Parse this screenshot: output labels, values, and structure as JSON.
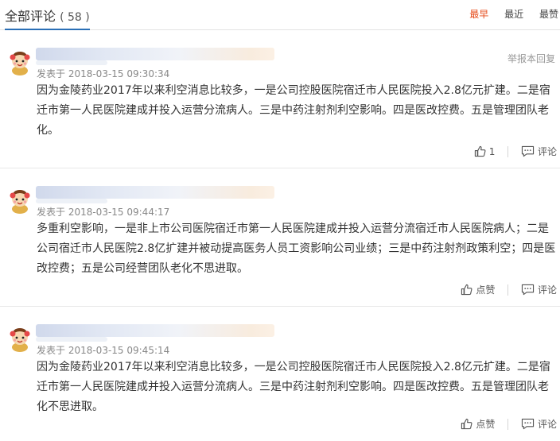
{
  "header": {
    "title": "全部评论",
    "count": "( 58 )",
    "sorts": [
      "最早",
      "最近",
      "最赞"
    ],
    "active_sort": "最早"
  },
  "comments": [
    {
      "time": "发表于 2018-03-15 09:30:34",
      "report": "举报本回复",
      "text": "因为金陵药业2017年以来利空消息比较多，一是公司控股医院宿迁市人民医院投入2.8亿元扩建。二是宿迁市第一人民医院建成并投入运营分流病人。三是中药注射剂利空影响。四是医改控费。五是管理团队老化。",
      "like_label": "1",
      "reply_label": "评论"
    },
    {
      "time": "发表于 2018-03-15 09:44:17",
      "report": "",
      "text": "多重利空影响，一是非上市公司医院宿迁市第一人民医院建成并投入运营分流宿迁市人民医院病人；二是公司宿迁市人民医院2.8亿扩建并被动提高医务人员工资影响公司业绩；三是中药注射剂政策利空；四是医改控费；五是公司经营团队老化不思进取。",
      "like_label": "点赞",
      "reply_label": "评论"
    },
    {
      "time": "发表于 2018-03-15 09:45:14",
      "report": "",
      "text": "因为金陵药业2017年以来利空消息比较多，一是公司控股医院宿迁市人民医院投入2.8亿元扩建。二是宿迁市第一人民医院建成并投入运营分流病人。三是中药注射剂利空影响。四是医改控费。五是管理团队老化不思进取。",
      "like_label": "点赞",
      "reply_label": "评论"
    }
  ],
  "colors": {
    "accent": "#2a6fb6",
    "active_sort": "#e64a19",
    "meta": "#888888"
  },
  "icons": {
    "avatar": "cartoon-avatar-icon",
    "like": "thumbs-up-icon",
    "reply": "comment-icon"
  }
}
